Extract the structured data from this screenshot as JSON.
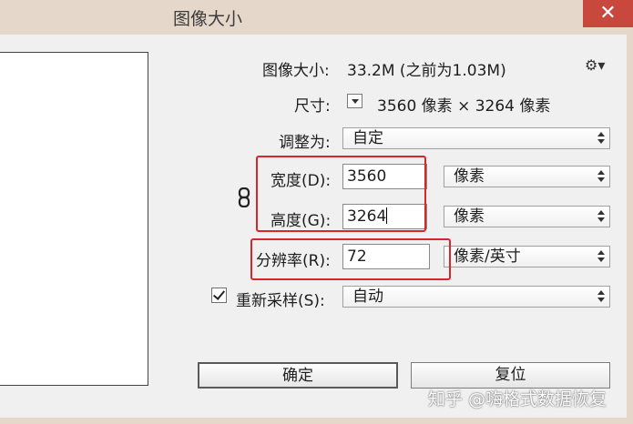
{
  "window": {
    "title": "图像大小",
    "close_glyph": "✕"
  },
  "info": {
    "size_label": "图像大小:",
    "size_value": "33.2M (之前为1.03M)",
    "dimensions_label": "尺寸:",
    "dimensions_value": "3560 像素  ×  3264 像素"
  },
  "fit_to": {
    "label": "调整为:",
    "value": "自定"
  },
  "width": {
    "label": "宽度(D):",
    "value": "3560",
    "unit": "像素"
  },
  "height": {
    "label": "高度(G):",
    "value": "3264",
    "unit": "像素"
  },
  "resolution": {
    "label": "分辨率(R):",
    "value": "72",
    "unit": "像素/英寸"
  },
  "resample": {
    "checked": true,
    "label": "重新采样(S):",
    "value": "自动"
  },
  "buttons": {
    "ok": "确定",
    "reset": "复位"
  },
  "watermark": "知乎 @嗨格式数据恢复",
  "colors": {
    "highlight_box": "#d9262b",
    "title_bar": "#e6d7cb",
    "close_button": "#c9483d"
  }
}
